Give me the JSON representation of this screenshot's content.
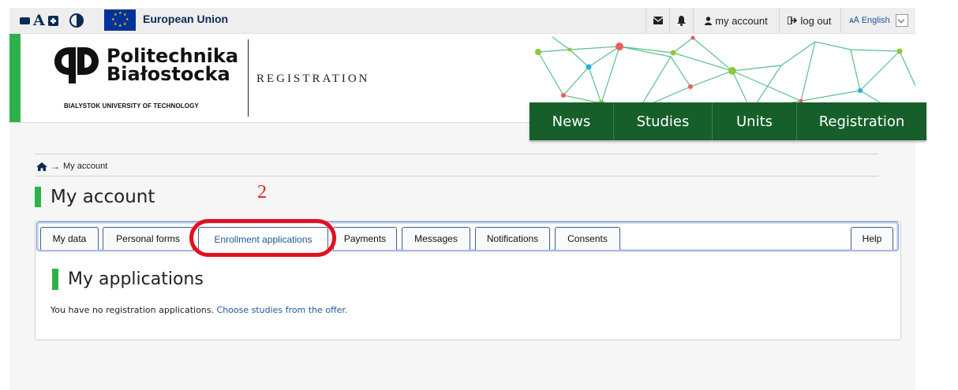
{
  "topbar": {
    "eu_label": "European Union",
    "account_label": "my account",
    "logout_label": "log out",
    "language_label": "English",
    "icons": [
      "decrease-font-icon",
      "font-size-icon",
      "increase-font-icon",
      "contrast-icon",
      "eu-flag-icon",
      "envelope-icon",
      "bell-icon",
      "user-icon",
      "logout-icon",
      "language-icon"
    ]
  },
  "header": {
    "logo_line1": "Politechnika",
    "logo_line2": "Białostocka",
    "logo_sub": "BIALYSTOK UNIVERSITY OF TECHNOLOGY",
    "section_title": "REGISTRATION",
    "accent_color": "#2db24a",
    "nav_color": "#165f2b"
  },
  "mainnav": {
    "items": [
      "News",
      "Studies",
      "Units",
      "Registration"
    ]
  },
  "breadcrumb": {
    "current": "My account"
  },
  "page": {
    "title": "My account",
    "annotation_number": "2"
  },
  "tabs": {
    "items": [
      {
        "label": "My data"
      },
      {
        "label": "Personal forms"
      },
      {
        "label": "Enrollment applications",
        "active": true
      },
      {
        "label": "Payments"
      },
      {
        "label": "Messages"
      },
      {
        "label": "Notifications"
      },
      {
        "label": "Consents"
      }
    ],
    "help_label": "Help"
  },
  "applications": {
    "title": "My applications",
    "message_prefix": "You have no registration applications.",
    "message_link": "Choose studies from the offer."
  }
}
